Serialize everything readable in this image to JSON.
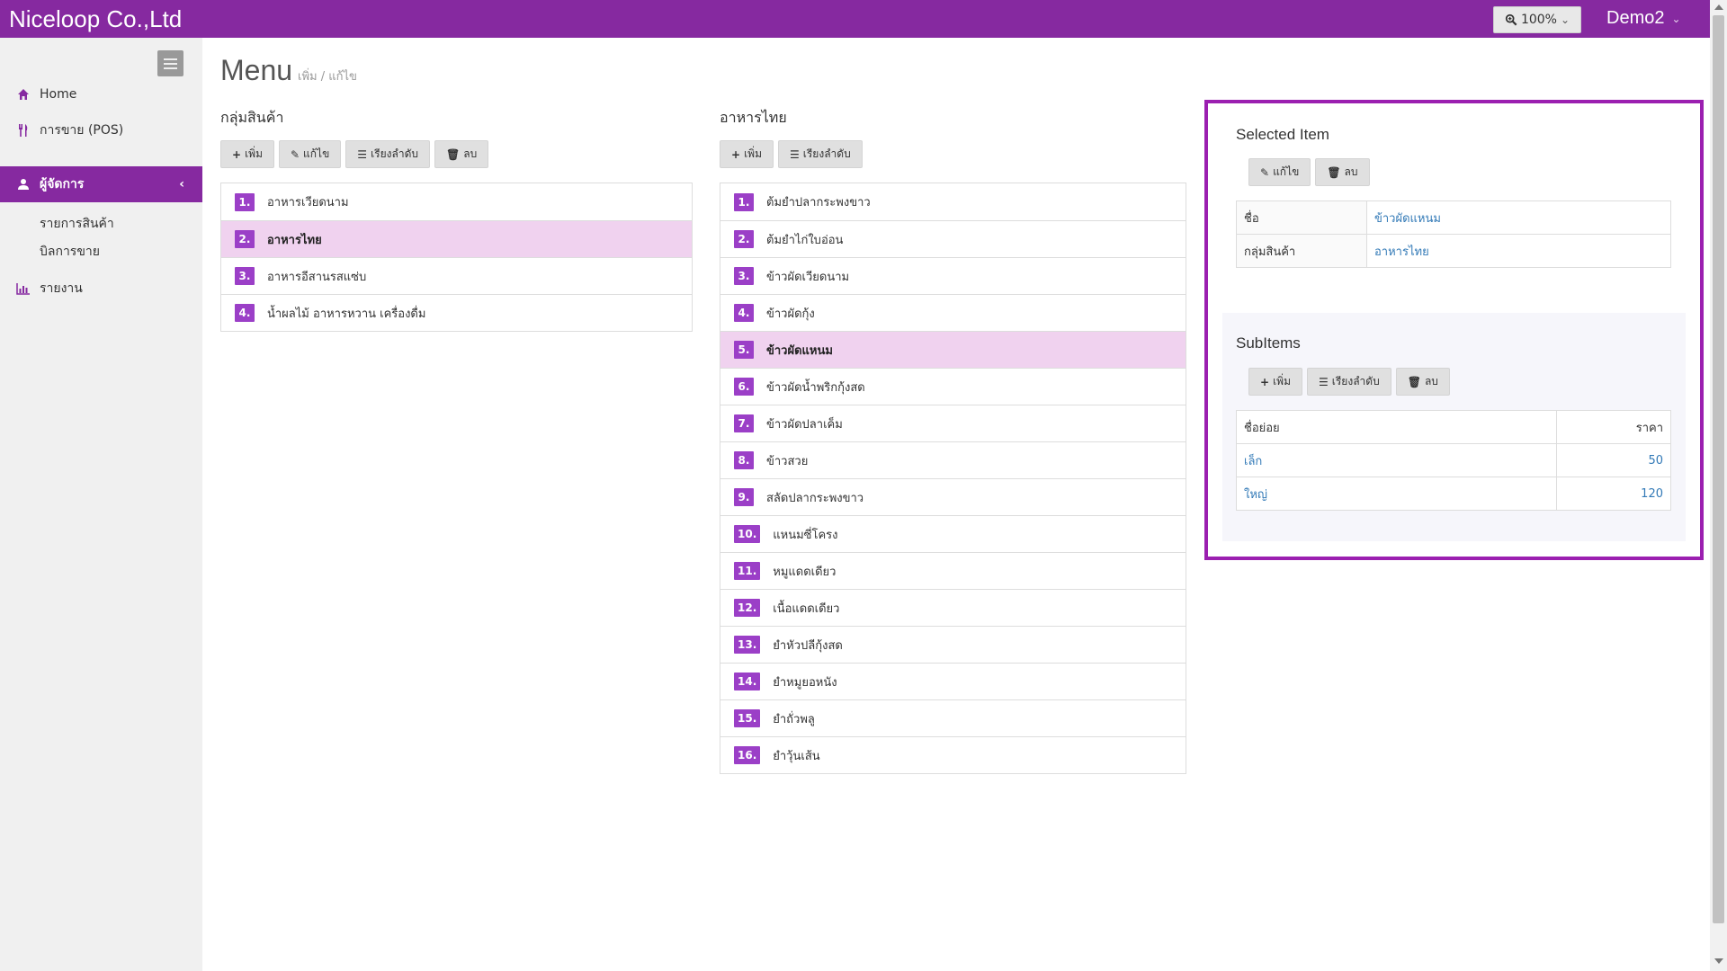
{
  "app": {
    "brand": "Niceloop Co.,Ltd",
    "zoom": "100%",
    "user": "Demo2"
  },
  "sidebar": {
    "items": [
      {
        "label": "Home",
        "icon": "home-icon"
      },
      {
        "label": "การขาย (POS)",
        "icon": "cutlery-icon"
      },
      {
        "label": "ผู้จัดการ",
        "icon": "user-icon",
        "active": true
      },
      {
        "label": "รายงาน",
        "icon": "bar-chart-icon"
      }
    ],
    "subitems": [
      "รายการสินค้า",
      "บิลการขาย"
    ]
  },
  "page": {
    "title": "Menu",
    "subtitle": "เพิ่ม / แก้ไข"
  },
  "buttons": {
    "add": "เพิ่ม",
    "edit": "แก้ไข",
    "sort": "เรียงลำดับ",
    "delete": "ลบ"
  },
  "groups": {
    "title": "กลุ่มสินค้า",
    "items": [
      {
        "num": "1.",
        "label": "อาหารเวียดนาม"
      },
      {
        "num": "2.",
        "label": "อาหารไทย"
      },
      {
        "num": "3.",
        "label": "อาหารอีสานรสแซ่บ"
      },
      {
        "num": "4.",
        "label": "น้ำผลไม้ อาหารหวาน เครื่องดื่ม"
      }
    ],
    "selected_index": 1
  },
  "products": {
    "title": "อาหารไทย",
    "items": [
      {
        "num": "1.",
        "label": "ต้มยำปลากระพงขาว"
      },
      {
        "num": "2.",
        "label": "ต้มยำไก่ใบอ่อน"
      },
      {
        "num": "3.",
        "label": "ข้าวผัดเวียดนาม"
      },
      {
        "num": "4.",
        "label": "ข้าวผัดกุ้ง"
      },
      {
        "num": "5.",
        "label": "ข้าวผัดแหนม"
      },
      {
        "num": "6.",
        "label": "ข้าวผัดน้ำพริกกุ้งสด"
      },
      {
        "num": "7.",
        "label": "ข้าวผัดปลาเค็ม"
      },
      {
        "num": "8.",
        "label": "ข้าวสวย"
      },
      {
        "num": "9.",
        "label": "สลัดปลากระพงขาว"
      },
      {
        "num": "10.",
        "label": "แหนมซี่โครง"
      },
      {
        "num": "11.",
        "label": "หมูแดดเดียว"
      },
      {
        "num": "12.",
        "label": "เนื้อแดดเดียว"
      },
      {
        "num": "13.",
        "label": "ยำหัวปลีกุ้งสด"
      },
      {
        "num": "14.",
        "label": "ยำหมูยอหนัง"
      },
      {
        "num": "15.",
        "label": "ยำถั่วพลู"
      },
      {
        "num": "16.",
        "label": "ยำวุ้นเส้น"
      }
    ],
    "selected_index": 4
  },
  "selected_item": {
    "title": "Selected Item",
    "name_label": "ชื่อ",
    "name_value": "ข้าวผัดแหนม",
    "group_label": "กลุ่มสินค้า",
    "group_value": "อาหารไทย"
  },
  "subitems": {
    "title": "SubItems",
    "col_name": "ชื่อย่อย",
    "col_price": "ราคา",
    "rows": [
      {
        "name": "เล็ก",
        "price": "50"
      },
      {
        "name": "ใหญ่",
        "price": "120"
      }
    ]
  },
  "colors": {
    "accent": "#8629a0",
    "badge": "#9b3fc7",
    "selected_row": "#f0d2ef",
    "link": "#337ab7"
  }
}
